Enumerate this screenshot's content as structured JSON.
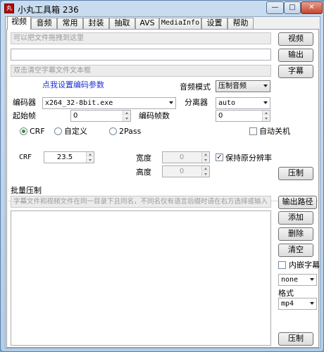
{
  "window": {
    "title": "小丸工具箱 236",
    "icon_label": "丸"
  },
  "tabs": [
    {
      "label": "视频"
    },
    {
      "label": "音频"
    },
    {
      "label": "常用"
    },
    {
      "label": "封装"
    },
    {
      "label": "抽取"
    },
    {
      "label": "AVS"
    },
    {
      "label": "MediaInfo"
    },
    {
      "label": "设置"
    },
    {
      "label": "帮助"
    }
  ],
  "video": {
    "video_hint": "可以把文件拖拽到这里",
    "video_button": "视频",
    "output_value": "",
    "output_button": "输出",
    "subtitle_hint": "双击清空字幕文件文本框",
    "subtitle_button": "字幕",
    "params_link": "点我设置编码参数",
    "audio_mode_label": "音频模式",
    "audio_mode_value": "压制音频",
    "encoder_label": "编码器",
    "encoder_value": "x264_32-8bit.exe",
    "splitter_label": "分离器",
    "splitter_value": "auto",
    "start_frame_label": "起始帧",
    "start_frame_value": "0",
    "encode_frames_label": "编码帧数",
    "encode_frames_value": "0",
    "radio_crf": "CRF",
    "radio_custom": "自定义",
    "radio_2pass": "2Pass",
    "auto_shutdown_label": "自动关机",
    "crf_label": "CRF",
    "crf_value": "23.5",
    "width_label": "宽度",
    "width_value": "0",
    "height_label": "高度",
    "height_value": "0",
    "keep_res_label": "保持原分辨率",
    "encode_button": "压制"
  },
  "batch": {
    "title": "批量压制",
    "hint": "字幕文件和视频文件在同一目录下且同名，不同名仅有语言后缀时请在右方选择或输入",
    "output_path_button": "输出路径",
    "add_button": "添加",
    "delete_button": "删除",
    "clear_button": "清空",
    "embed_sub_label": "内嵌字幕",
    "sub_lang_value": "none",
    "format_label": "格式",
    "format_value": "mp4",
    "encode_button": "压制"
  },
  "caption_buttons": {
    "minimize": "—",
    "maximize": "□",
    "close": "✕"
  }
}
